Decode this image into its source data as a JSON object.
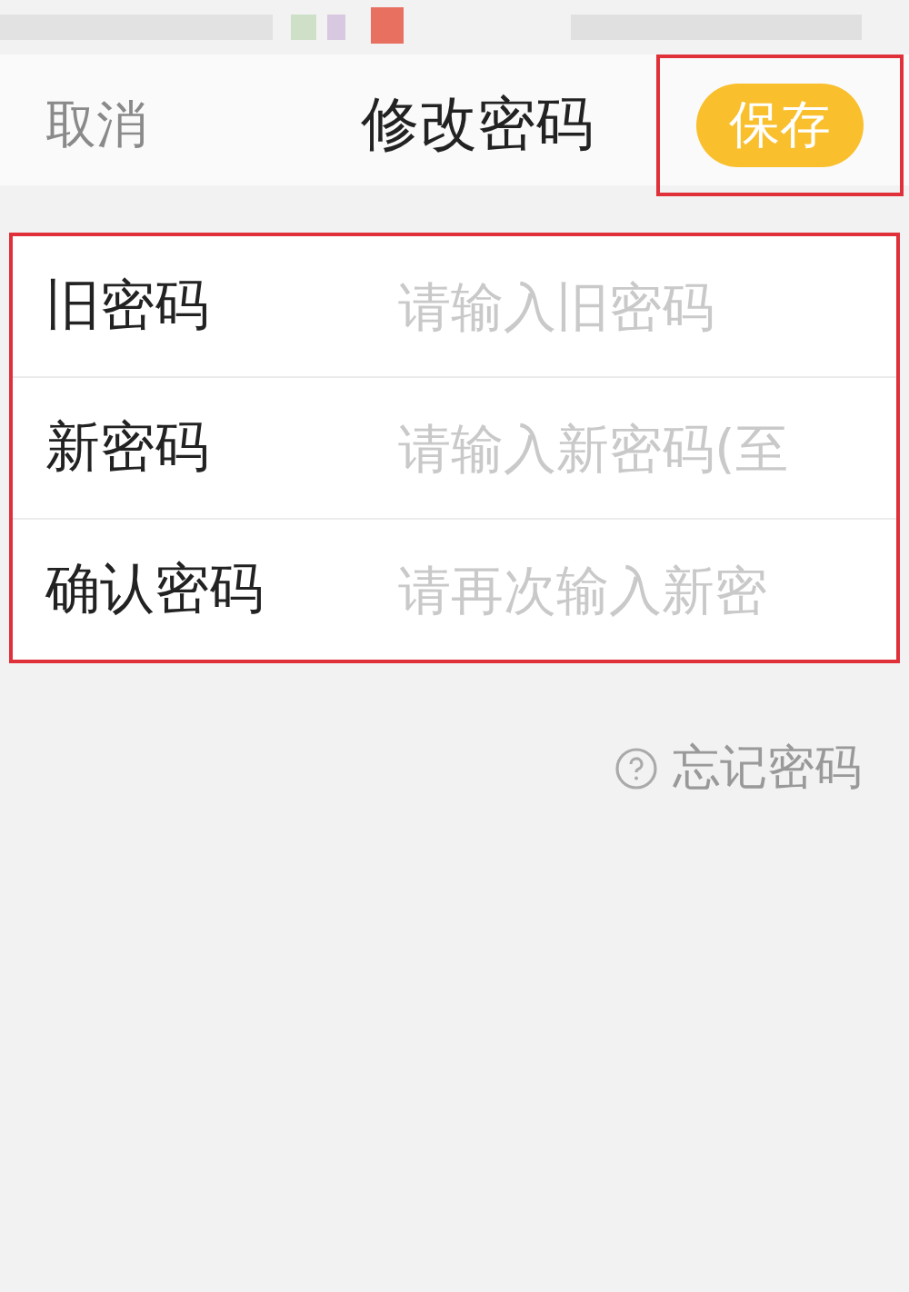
{
  "header": {
    "cancel": "取消",
    "title": "修改密码",
    "save": {
      "label": "保存",
      "highlighted": true
    }
  },
  "form": {
    "highlighted": true,
    "fields": [
      {
        "label": "旧密码",
        "placeholder": "请输入旧密码"
      },
      {
        "label": "新密码",
        "placeholder": "请输入新密码(至"
      },
      {
        "label": "确认密码",
        "placeholder": "请再次输入新密"
      }
    ]
  },
  "forgot": "忘记密码"
}
